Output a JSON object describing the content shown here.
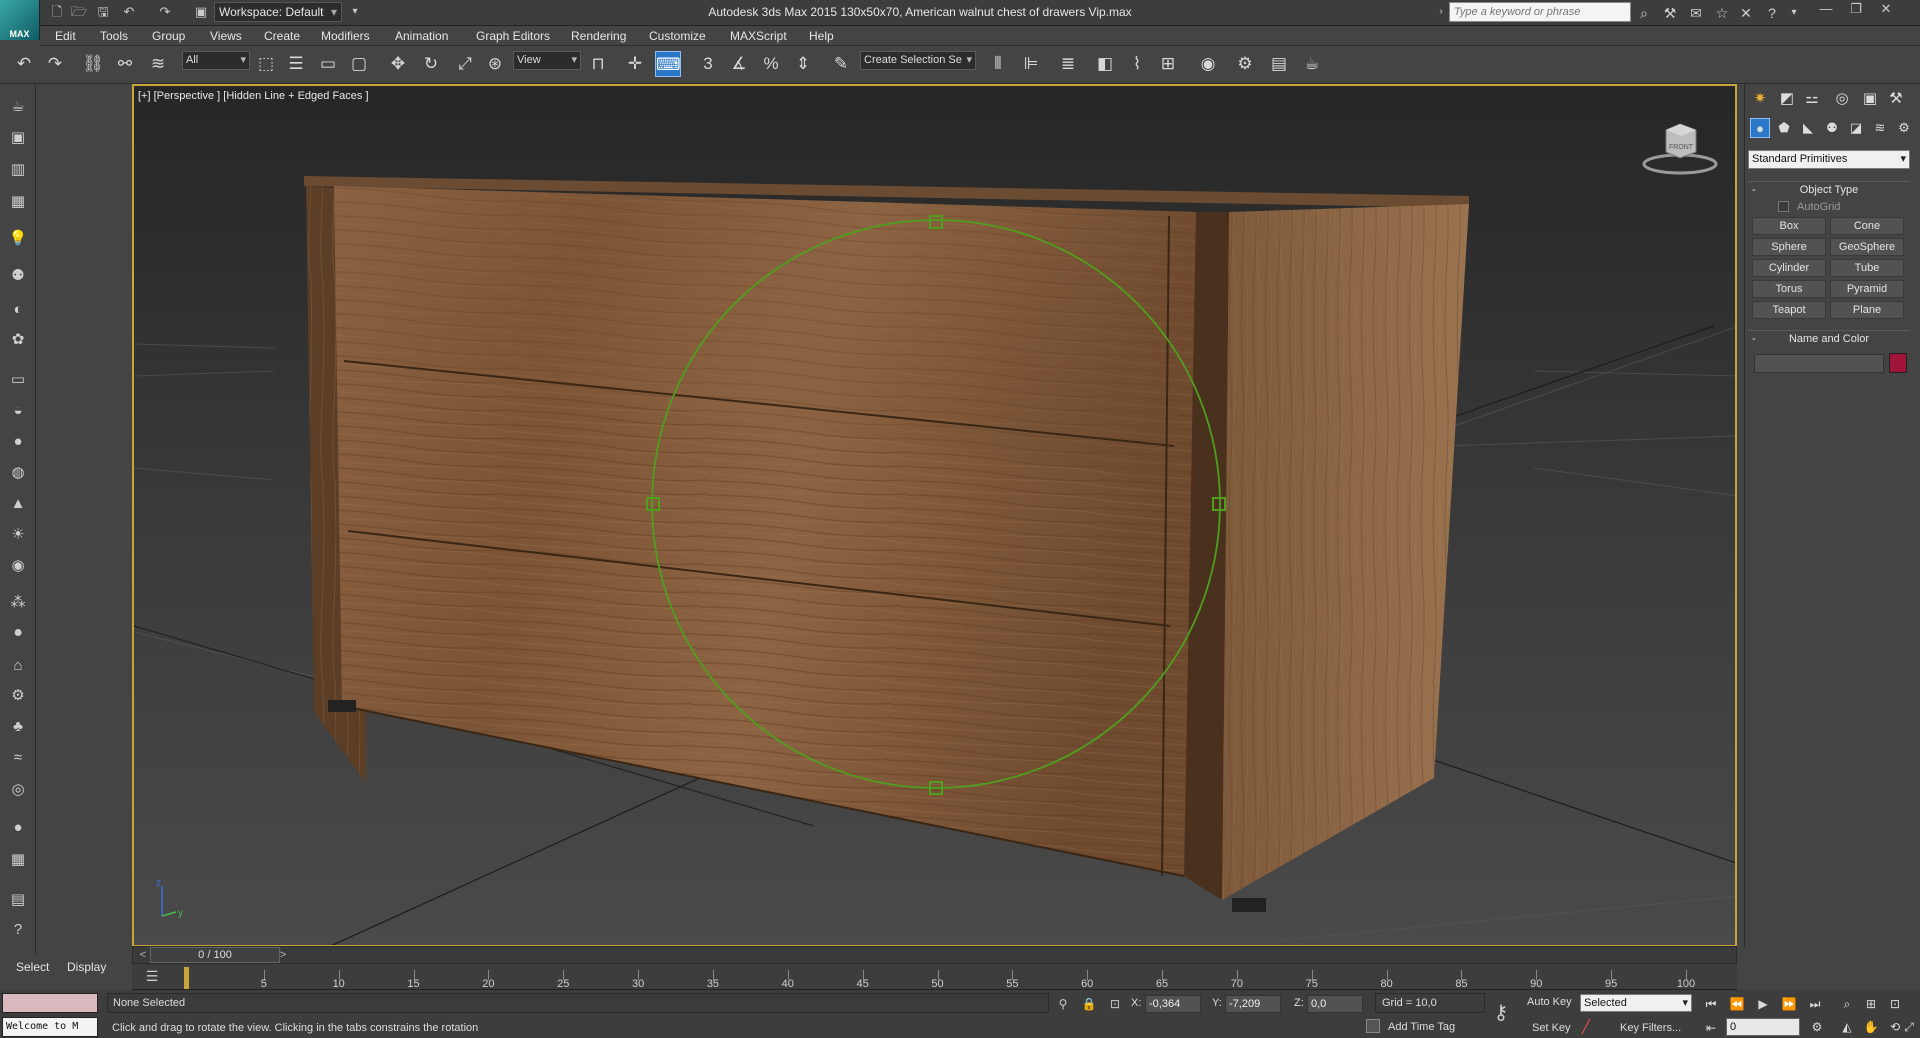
{
  "app": {
    "title": "Autodesk 3ds Max 2015     130x50x70, American walnut chest of drawers Vip.max",
    "logo_label": "MAX",
    "workspace": "Workspace: Default",
    "search_placeholder": "Type a keyword or phrase"
  },
  "menus": [
    "Edit",
    "Tools",
    "Group",
    "Views",
    "Create",
    "Modifiers",
    "Animation",
    "Graph Editors",
    "Rendering",
    "Customize",
    "MAXScript",
    "Help"
  ],
  "toolbar": {
    "selection_filter": "All",
    "reference_coord": "View",
    "named_selection_placeholder": "Create Selection Se",
    "snap_labels": {
      "snap3": "3",
      "angle": "",
      "percent": "%",
      "spinner": ""
    }
  },
  "viewport": {
    "label": "[+] [Perspective ] [Hidden Line + Edged Faces ]",
    "viewcube_label": "FRONT",
    "axis_z": "z",
    "axis_y": "y"
  },
  "command_panel": {
    "category_dropdown": "Standard Primitives",
    "object_type_title": "Object Type",
    "autogrid_label": "AutoGrid",
    "primitives": [
      "Box",
      "Cone",
      "Sphere",
      "GeoSphere",
      "Cylinder",
      "Tube",
      "Torus",
      "Pyramid",
      "Teapot",
      "Plane"
    ],
    "name_color_title": "Name and Color",
    "name_value": "",
    "color": "#a0143c"
  },
  "left_tabs": {
    "select": "Select",
    "display": "Display"
  },
  "timeline": {
    "slider_label": "0 / 100",
    "ticks": [
      "5",
      "10",
      "15",
      "20",
      "25",
      "30",
      "35",
      "40",
      "45",
      "50",
      "55",
      "60",
      "65",
      "70",
      "75",
      "80",
      "85",
      "90",
      "95",
      "100"
    ]
  },
  "status": {
    "maxscript_listener": "Welcome to M",
    "selection": "None Selected",
    "prompt": "Click and drag to rotate the view.  Clicking in the tabs constrains the rotation",
    "x_label": "X:",
    "x_value": "-0,364",
    "y_label": "Y:",
    "y_value": "-7,209",
    "z_label": "Z:",
    "z_value": "0,0",
    "grid": "Grid = 10,0",
    "add_time_tag": "Add Time Tag",
    "auto_key": "Auto Key",
    "set_key": "Set Key",
    "selected_dropdown": "Selected",
    "key_filters": "Key Filters...",
    "current_frame": "0"
  }
}
